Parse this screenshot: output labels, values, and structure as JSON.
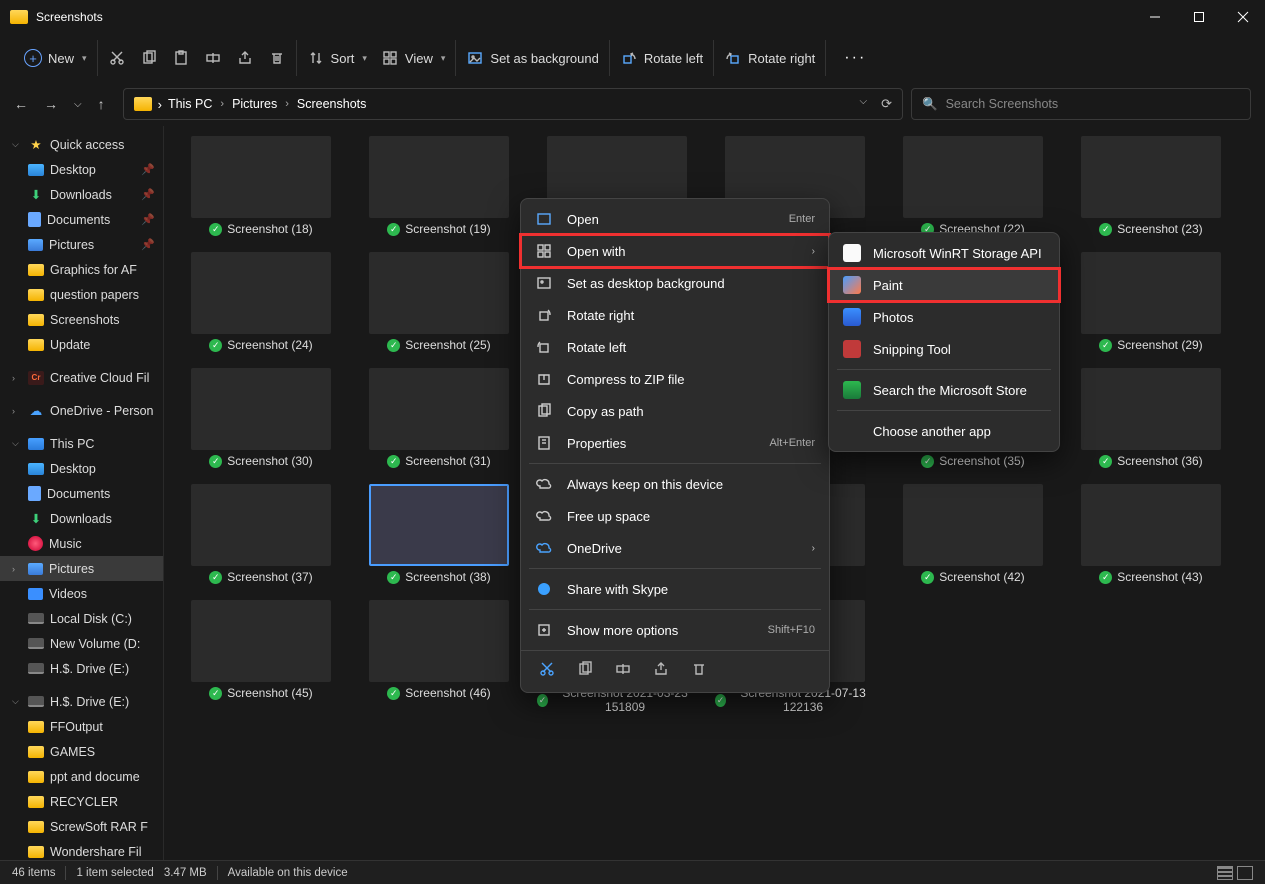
{
  "window": {
    "title": "Screenshots"
  },
  "toolbar": {
    "new": "New",
    "sort": "Sort",
    "view": "View",
    "set_bg": "Set as background",
    "rotate_left": "Rotate left",
    "rotate_right": "Rotate right"
  },
  "breadcrumb": {
    "pc": "This PC",
    "pictures": "Pictures",
    "screenshots": "Screenshots"
  },
  "search": {
    "placeholder": "Search Screenshots"
  },
  "sidebar": {
    "quick": "Quick access",
    "desktop": "Desktop",
    "downloads": "Downloads",
    "documents": "Documents",
    "pictures": "Pictures",
    "graphics": "Graphics for AF",
    "qpapers": "question papers",
    "screenshots": "Screenshots",
    "update": "Update",
    "ccfiles": "Creative Cloud Fil",
    "onedrive": "OneDrive - Person",
    "thispc": "This PC",
    "pc_desktop": "Desktop",
    "pc_documents": "Documents",
    "pc_downloads": "Downloads",
    "pc_music": "Music",
    "pc_pictures": "Pictures",
    "pc_videos": "Videos",
    "localdisk": "Local Disk (C:)",
    "newvol": "New Volume (D:",
    "hs1": "H.$. Drive (E:)",
    "hs2": "H.$. Drive (E:)",
    "ffoutput": "FFOutput",
    "games": "GAMES",
    "ppt": "ppt and docume",
    "recycler": "RECYCLER",
    "screwsoft": "ScrewSoft RAR F",
    "wondershare": "Wondershare Fil"
  },
  "files": [
    {
      "label": "Screenshot (18)"
    },
    {
      "label": "Screenshot (19)"
    },
    {
      "label": ""
    },
    {
      "label": ""
    },
    {
      "label": "Screenshot (22)"
    },
    {
      "label": "Screenshot (23)"
    },
    {
      "label": "Screenshot (24)"
    },
    {
      "label": "Screenshot (25)"
    },
    {
      "label": ""
    },
    {
      "label": ""
    },
    {
      "label": ""
    },
    {
      "label": "Screenshot (29)"
    },
    {
      "label": "Screenshot (30)"
    },
    {
      "label": "Screenshot (31)"
    },
    {
      "label": ""
    },
    {
      "label": ""
    },
    {
      "label": "Screenshot (35)"
    },
    {
      "label": "Screenshot (36)"
    },
    {
      "label": "Screenshot (37)"
    },
    {
      "label": "Screenshot (38)"
    },
    {
      "label": ""
    },
    {
      "label": ""
    },
    {
      "label": "Screenshot (42)"
    },
    {
      "label": "Screenshot (43)"
    },
    {
      "label": "Screenshot (45)"
    },
    {
      "label": "Screenshot (46)"
    },
    {
      "label": "Screenshot 2021-03-23 151809"
    },
    {
      "label": "Screenshot 2021-07-13 122136"
    }
  ],
  "context_menu": {
    "open": "Open",
    "open_hint": "Enter",
    "open_with": "Open with",
    "set_bg": "Set as desktop background",
    "rot_r": "Rotate right",
    "rot_l": "Rotate left",
    "zip": "Compress to ZIP file",
    "copy_path": "Copy as path",
    "props": "Properties",
    "props_hint": "Alt+Enter",
    "keep": "Always keep on this device",
    "free": "Free up space",
    "onedrive": "OneDrive",
    "skype": "Share with Skype",
    "more": "Show more options",
    "more_hint": "Shift+F10"
  },
  "open_with_menu": {
    "winrt": "Microsoft WinRT Storage API",
    "paint": "Paint",
    "photos": "Photos",
    "snip": "Snipping Tool",
    "store": "Search the Microsoft Store",
    "another": "Choose another app"
  },
  "status": {
    "count": "46 items",
    "selected": "1 item selected",
    "size": "3.47 MB",
    "avail": "Available on this device"
  }
}
